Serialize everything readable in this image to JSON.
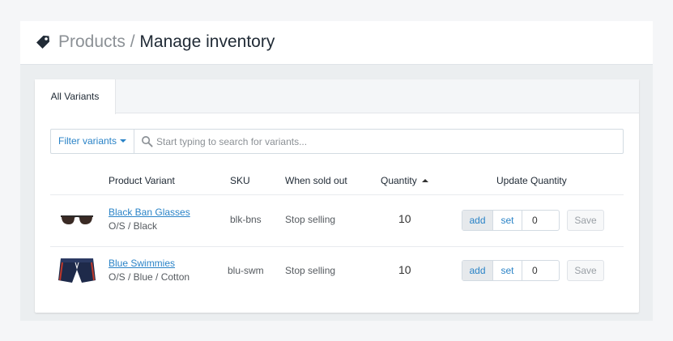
{
  "header": {
    "breadcrumb_parent": "Products",
    "breadcrumb_separator": " / ",
    "page_title": "Manage inventory",
    "icon": "tag-icon"
  },
  "tabs": [
    {
      "label": "All Variants",
      "active": true
    }
  ],
  "filter": {
    "button_label": "Filter variants",
    "search_placeholder": "Start typing to search for variants...",
    "search_value": ""
  },
  "table": {
    "columns": {
      "product_variant": "Product Variant",
      "sku": "SKU",
      "when_sold_out": "When sold out",
      "quantity": "Quantity",
      "update_quantity": "Update Quantity"
    },
    "sort": {
      "column": "quantity",
      "direction": "ascending"
    },
    "rows": [
      {
        "name": "Black Ban Glasses",
        "options": "O/S / Black",
        "sku": "blk-bns",
        "when_sold_out": "Stop selling",
        "quantity": "10",
        "thumbnail": "sunglasses-icon",
        "mode_add": "add",
        "mode_set": "set",
        "mode_selected": "add",
        "input_value": "0",
        "save_label": "Save"
      },
      {
        "name": "Blue Swimmies",
        "options": "O/S / Blue / Cotton",
        "sku": "blu-swm",
        "when_sold_out": "Stop selling",
        "quantity": "10",
        "thumbnail": "swim-shorts-icon",
        "mode_add": "add",
        "mode_set": "set",
        "mode_selected": "add",
        "input_value": "0",
        "save_label": "Save"
      }
    ]
  },
  "colors": {
    "link": "#2a83c7",
    "title": "#212b36",
    "breadcrumb": "#8c9196",
    "page_bg": "#ebeef0"
  }
}
